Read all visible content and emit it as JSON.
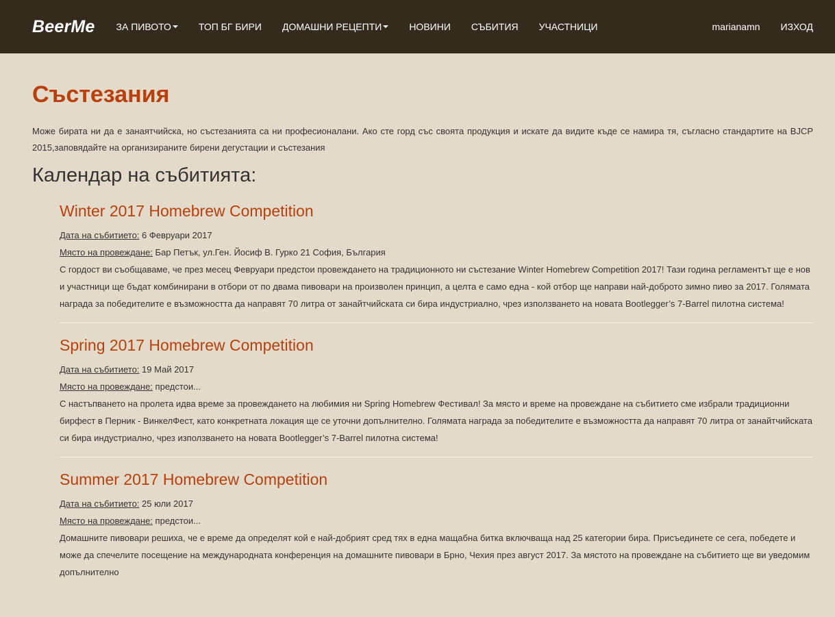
{
  "nav": {
    "brand": "BeerMe",
    "items": [
      {
        "label": "ЗА ПИВОТО",
        "dropdown": true
      },
      {
        "label": "ТОП БГ БИРИ",
        "dropdown": false
      },
      {
        "label": "ДОМАШНИ РЕЦЕПТИ",
        "dropdown": true
      },
      {
        "label": "НОВИНИ",
        "dropdown": false
      },
      {
        "label": "СЪБИТИЯ",
        "dropdown": false
      },
      {
        "label": "УЧАСТНИЦИ",
        "dropdown": false
      }
    ],
    "username": "marianamn",
    "logout": "ИЗХОД"
  },
  "page": {
    "title": "Състезания",
    "intro": "Може бирата ни да е занаятчийска, но състезанията са ни професионалани. Ако сте горд със своята продукция и искате да видите къде се намира тя, съгласно стандартите на BJCP 2015,заповядайте на организираните бирени дегустации и състезания",
    "calendar_title": "Календар на събитията:"
  },
  "labels": {
    "date": "Дата на събитието:",
    "place": "Място на провеждане:"
  },
  "events": [
    {
      "title": "Winter 2017 Homebrew Competition",
      "date": "6 Февруари 2017",
      "place": "Бар Петък, ул.Ген. Йосиф В. Гурко 21 София, България",
      "description": "С гордост ви съобщаваме, че през месец Февруари предстои провеждането на традиционното ни състезание Winter Homebrew Competition 2017! Тази година регламентът ще е нов и участници ще бъдат комбинирани в отбори от по двама пивовари на произволен принцип, а целта е само една - кой отбор ще направи най-доброто зимно пиво за 2017. Голямата награда за победителите е възможността да направят 70 литра от занайтчийската си бира индустриално, чрез използването на новата Bootlegger’s 7-Barrel пилотна система!"
    },
    {
      "title": "Spring 2017 Homebrew Competition",
      "date": "19 Май 2017",
      "place": "предстои...",
      "description": "С настъпването на пролета идва време за провеждането на любимия ни Spring Homebrew Фестивал! За място и време на провеждане на събитието сме избрали традиционни бирфест в Перник - ВинкелФест, като конкретната локация ще се уточни допълнително. Голямата награда за победителите е възможността да направят 70 литра от занайтчийската си бира индустриално, чрез използването на новата Bootlegger’s 7-Barrel пилотна система!"
    },
    {
      "title": "Summer 2017 Homebrew Competition",
      "date": "25 юли 2017",
      "place": "предстои...",
      "description": "Домашните пивовари решиха, че е време да определят кой е най-добрият сред тях в една мащабна битка включваща над 25 категории бира. Присъединете се сега, победете и може да спечелите посещение на международната конференция на домашните пивовари в Брно, Чехия през август 2017. За мястото на провеждане на събитието ще ви уведомим допълнително"
    }
  ],
  "colors": {
    "navbar_bg": "#342a1d",
    "page_bg": "#e4dac9",
    "accent": "#b8400f"
  }
}
